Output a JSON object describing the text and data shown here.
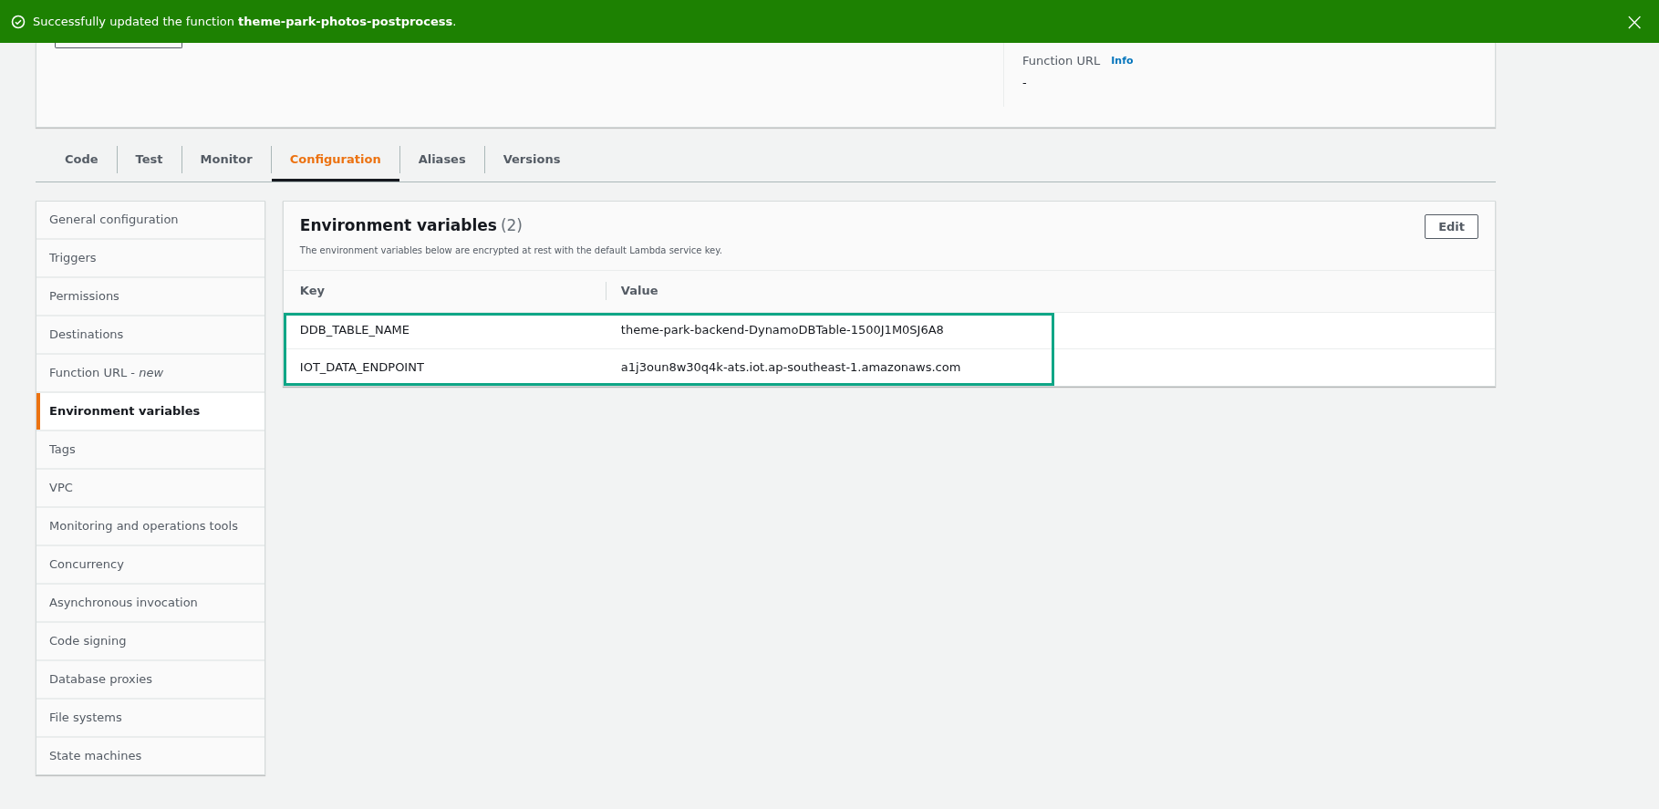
{
  "banner": {
    "message": "Successfully updated the function **theme-park-photos-postprocess**.",
    "close": "×"
  },
  "summary": {
    "function_url_label": "Function URL",
    "info_link": "Info",
    "function_url_value": "-"
  },
  "tabs": [
    {
      "label": "Code",
      "selected": false
    },
    {
      "label": "Test",
      "selected": false
    },
    {
      "label": "Monitor",
      "selected": false
    },
    {
      "label": "Configuration",
      "selected": true
    },
    {
      "label": "Aliases",
      "selected": false
    },
    {
      "label": "Versions",
      "selected": false
    }
  ],
  "sidebar": {
    "items": [
      {
        "label": "General configuration",
        "selected": false
      },
      {
        "label": "Triggers",
        "selected": false
      },
      {
        "label": "Permissions",
        "selected": false
      },
      {
        "label": "Destinations",
        "selected": false
      },
      {
        "label": "Function URL - *new*",
        "selected": false
      },
      {
        "label": "Environment variables",
        "selected": true
      },
      {
        "label": "Tags",
        "selected": false
      },
      {
        "label": "VPC",
        "selected": false
      },
      {
        "label": "Monitoring and operations tools",
        "selected": false
      },
      {
        "label": "Concurrency",
        "selected": false
      },
      {
        "label": "Asynchronous invocation",
        "selected": false
      },
      {
        "label": "Code signing",
        "selected": false
      },
      {
        "label": "Database proxies",
        "selected": false
      },
      {
        "label": "File systems",
        "selected": false
      },
      {
        "label": "State machines",
        "selected": false
      }
    ]
  },
  "panel": {
    "title": "Environment variables",
    "count": "(2)",
    "description": "The environment variables below are encrypted at rest with the default Lambda service key.",
    "edit_button": "Edit",
    "table": {
      "columns": [
        "Key",
        "Value"
      ],
      "rows": [
        {
          "key": "DDB_TABLE_NAME",
          "value": "theme-park-backend-DynamoDBTable-1500J1M0SJ6A8"
        },
        {
          "key": "IOT_DATA_ENDPOINT",
          "value": "a1j3oun8w30q4k-ats.iot.ap-southeast-1.amazonaws.com"
        }
      ]
    }
  }
}
